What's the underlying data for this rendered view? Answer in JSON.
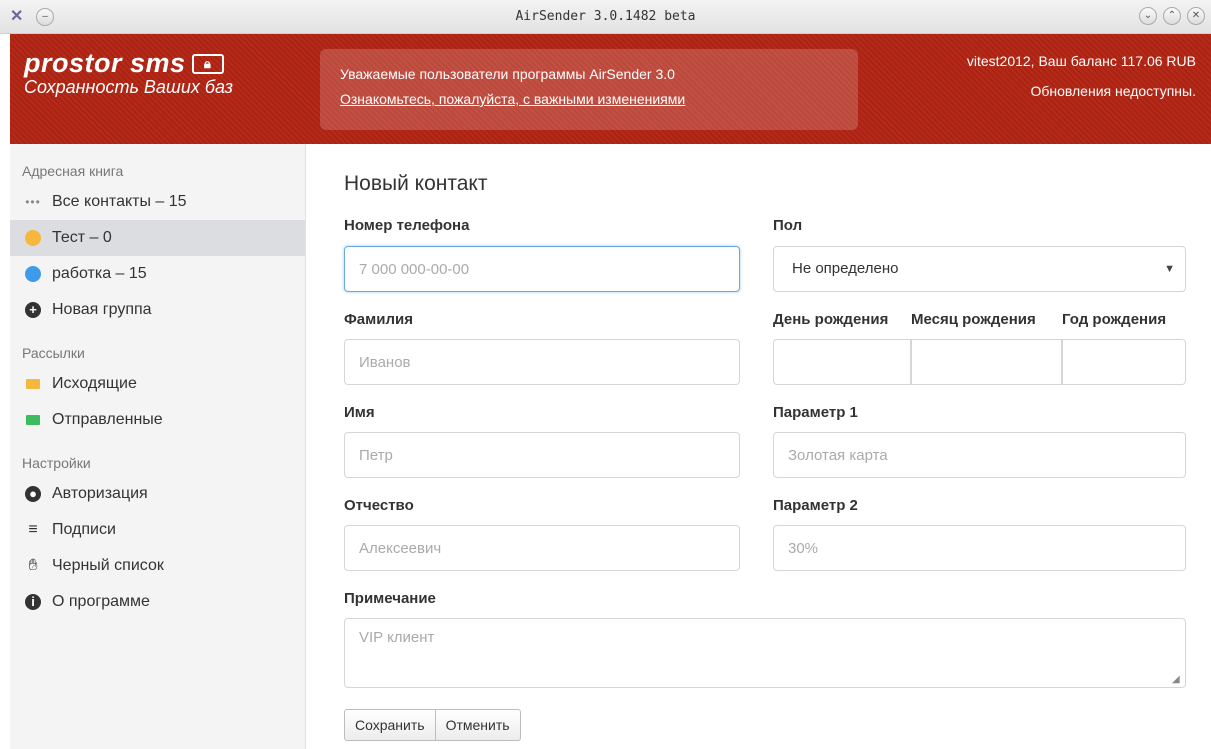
{
  "window": {
    "title": "AirSender 3.0.1482 beta"
  },
  "header": {
    "brand": "prostor sms",
    "tagline": "Сохранность Ваших баз",
    "notice_line1": "Уважаемые пользователи программы AirSender 3.0",
    "notice_line2": "Ознакомьтесь, пожалуйста, с важными изменениями",
    "account": "vitest2012, Ваш баланс 117.06 RUB",
    "updates": "Обновления недоступны."
  },
  "sidebar": {
    "section1": "Адресная книга",
    "all_contacts": "Все контакты – 15",
    "group_test": "Тест – 0",
    "group_work": "работка – 15",
    "new_group": "Новая группа",
    "section2": "Рассылки",
    "outgoing": "Исходящие",
    "sent": "Отправленные",
    "section3": "Настройки",
    "auth": "Авторизация",
    "signatures": "Подписи",
    "blacklist": "Черный список",
    "about": "О программе"
  },
  "colors": {
    "group_test": "#f5b83d",
    "group_work": "#3d9be9",
    "outgoing": "#f5b83d",
    "sent": "#3cbc5c",
    "header_red": "#b62a1a"
  },
  "form": {
    "title": "Новый контакт",
    "phone_label": "Номер телефона",
    "phone_placeholder": "7 000 000-00-00",
    "gender_label": "Пол",
    "gender_value": "Не определено",
    "lastname_label": "Фамилия",
    "lastname_placeholder": "Иванов",
    "birth_day_label": "День рождения",
    "birth_month_label": "Месяц рождения",
    "birth_year_label": "Год рождения",
    "firstname_label": "Имя",
    "firstname_placeholder": "Петр",
    "param1_label": "Параметр 1",
    "param1_placeholder": "Золотая карта",
    "middlename_label": "Отчество",
    "middlename_placeholder": "Алексеевич",
    "param2_label": "Параметр 2",
    "param2_placeholder": "30%",
    "note_label": "Примечание",
    "note_placeholder": "VIP клиент",
    "save": "Сохранить",
    "cancel": "Отменить"
  }
}
